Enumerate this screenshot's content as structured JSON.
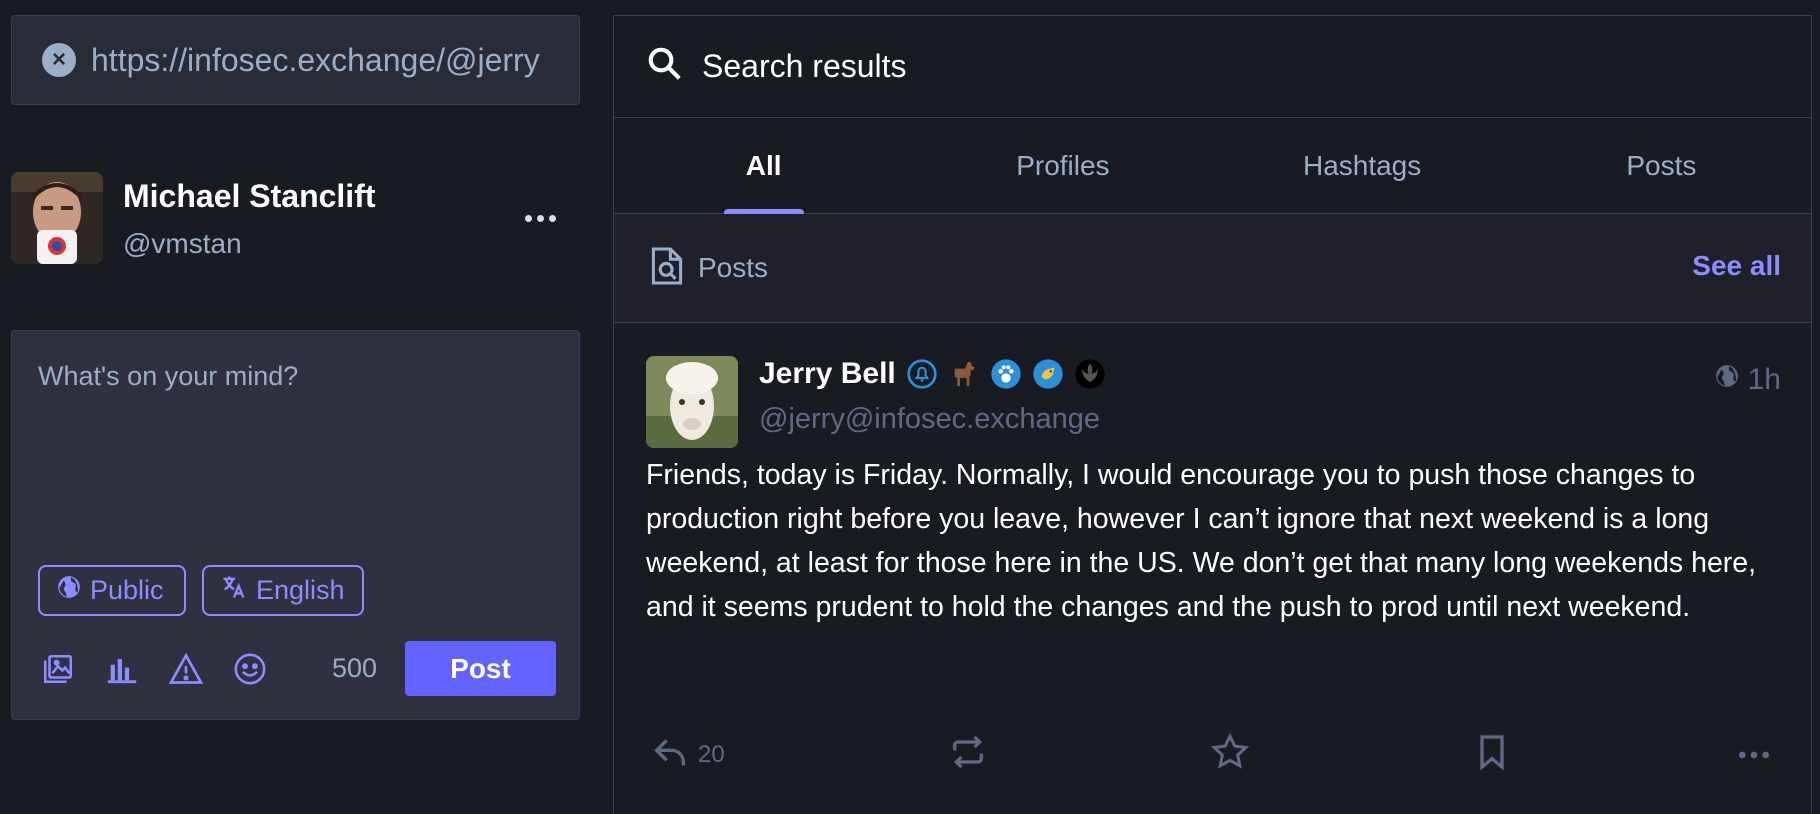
{
  "search": {
    "value": "https://infosec.exchange/@jerry",
    "clear_icon": "close-circle-icon"
  },
  "account": {
    "display_name": "Michael Stanclift",
    "handle": "@vmstan"
  },
  "composer": {
    "placeholder": "What's on your mind?",
    "visibility_label": "Public",
    "language_label": "English",
    "char_count": "500",
    "post_label": "Post"
  },
  "results": {
    "header_title": "Search results",
    "tabs": [
      {
        "label": "All",
        "active": true
      },
      {
        "label": "Profiles",
        "active": false
      },
      {
        "label": "Hashtags",
        "active": false
      },
      {
        "label": "Posts",
        "active": false
      }
    ],
    "section_title": "Posts",
    "see_all": "See all"
  },
  "status": {
    "display_name": "Jerry Bell",
    "handle": "@jerry@infosec.exchange",
    "time": "1h",
    "content": "Friends, today is Friday. Normally, I would encourage you to push those changes to production right before you leave, however I can’t ignore that next weekend is a long weekend, at least for those here in the US. We don’t get that many long weekends here, and it seems prudent to hold the changes and the push to prod until next weekend.",
    "reply_count": "20"
  },
  "colors": {
    "accent": "#8c8dff",
    "button": "#6364ff",
    "background": "#191b22",
    "panel": "#282c37",
    "muted": "#9baec8",
    "dim": "#606984"
  }
}
